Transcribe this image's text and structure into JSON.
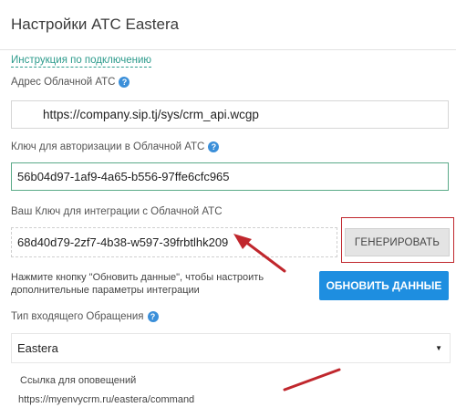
{
  "header": {
    "title": "Настройки АТС Eastera"
  },
  "instruction_link": "Инструкция по подключению",
  "cloud_address": {
    "label": "Адрес Облачной АТС",
    "value": "https://company.sip.tj/sys/crm_api.wcgp"
  },
  "auth_key": {
    "label": "Ключ для авторизации в Облачной АТС",
    "value": "56b04d97-1af9-4a65-b556-97ffe6cfc965"
  },
  "integration_key": {
    "label": "Ваш Ключ для интеграции с Облачной АТС",
    "value": "68d40d79-2zf7-4b38-w597-39frbtlhk209",
    "generate_label": "ГЕНЕРИРОВАТЬ"
  },
  "update": {
    "note": "Нажмите кнопку \"Обновить данные\", чтобы настроить дополнительные параметры интеграции",
    "button_label": "ОБНОВИТЬ ДАННЫЕ"
  },
  "incoming_type": {
    "label": "Тип входящего Обращения",
    "selected": "Eastera"
  },
  "notification": {
    "label": "Ссылка для оповещений",
    "url": "https://myenvycrm.ru/eastera/command"
  },
  "help_icon": "question-circle-icon",
  "colors": {
    "accent_blue": "#1e8ee0",
    "link_green": "#2d9b8c",
    "valid_border": "#5aaa88",
    "annotation_red": "#c0272d"
  }
}
